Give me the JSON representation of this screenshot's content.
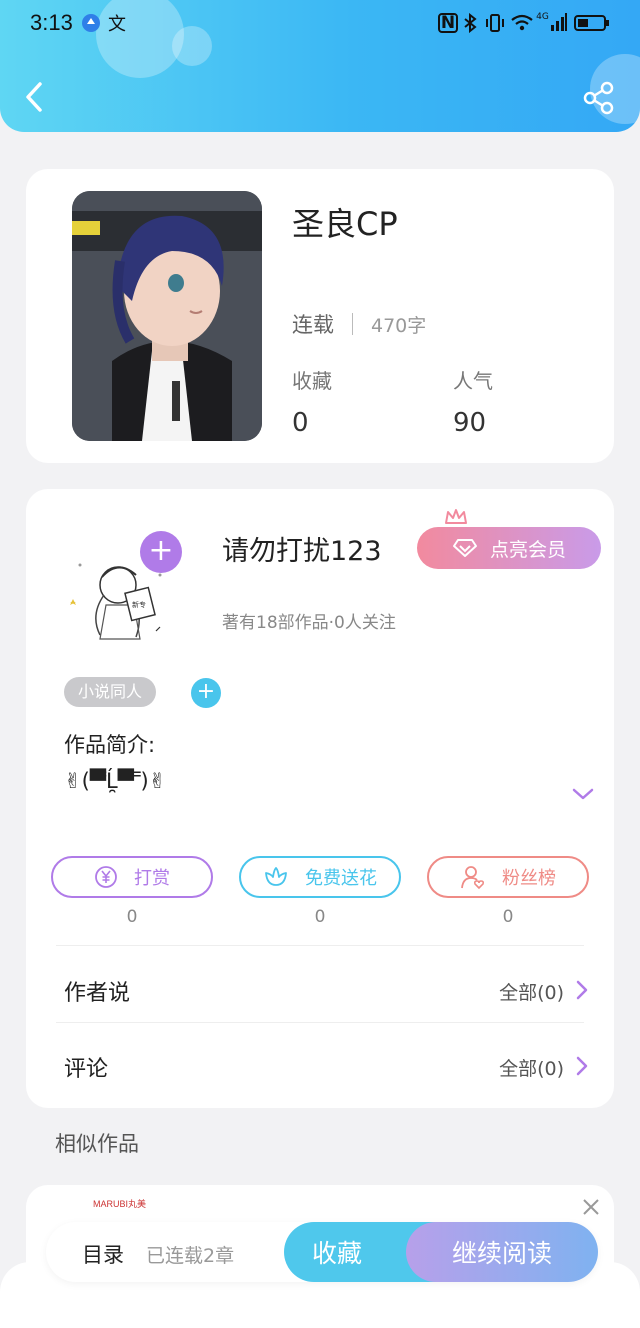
{
  "status_bar": {
    "time": "3:13",
    "icons": [
      "browser-app-icon",
      "translate-icon",
      "nfc-icon",
      "bluetooth-icon",
      "vibrate-icon",
      "wifi-icon",
      "signal-4g-icon",
      "battery-icon"
    ],
    "translate_glyph": "文",
    "nfc_glyph": "N",
    "network": "4G"
  },
  "header": {
    "background_start": "#5fd6f3",
    "background_end": "#34a8f5",
    "back_icon": "chevron-left-icon",
    "share_icon": "share-icon"
  },
  "book": {
    "title": "圣良CP",
    "status": "连载",
    "word_count": "470字",
    "favorites_label": "收藏",
    "favorites_value": "0",
    "popularity_label": "人气",
    "popularity_value": "90"
  },
  "author": {
    "name": "请勿打扰123",
    "vip_label": "点亮会员",
    "meta": "著有18部作品·0人关注",
    "tag": "小说同人",
    "intro_title": "作品简介:",
    "intro_text": "✌(▀̿Ĺ̯▀̿ ̿)✌",
    "avatar_badge_text": "新专"
  },
  "actions": [
    {
      "label": "打赏",
      "count": "0",
      "color": "#b07be8",
      "icon": "yen-coin-icon"
    },
    {
      "label": "免费送花",
      "count": "0",
      "color": "#49c5ec",
      "icon": "flower-icon"
    },
    {
      "label": "粉丝榜",
      "count": "0",
      "color": "#ef8b86",
      "icon": "fan-user-icon"
    }
  ],
  "rows": [
    {
      "label": "作者说",
      "all": "全部(0)"
    },
    {
      "label": "评论",
      "all": "全部(0)"
    }
  ],
  "similar_title": "相似作品",
  "ad": {
    "brand": "MARUBI丸美"
  },
  "bottom_bar": {
    "toc_label": "目录",
    "chapters": "已连载2章",
    "collect_label": "收藏",
    "continue_label": "继续阅读",
    "accent": "#4fc8ec"
  }
}
